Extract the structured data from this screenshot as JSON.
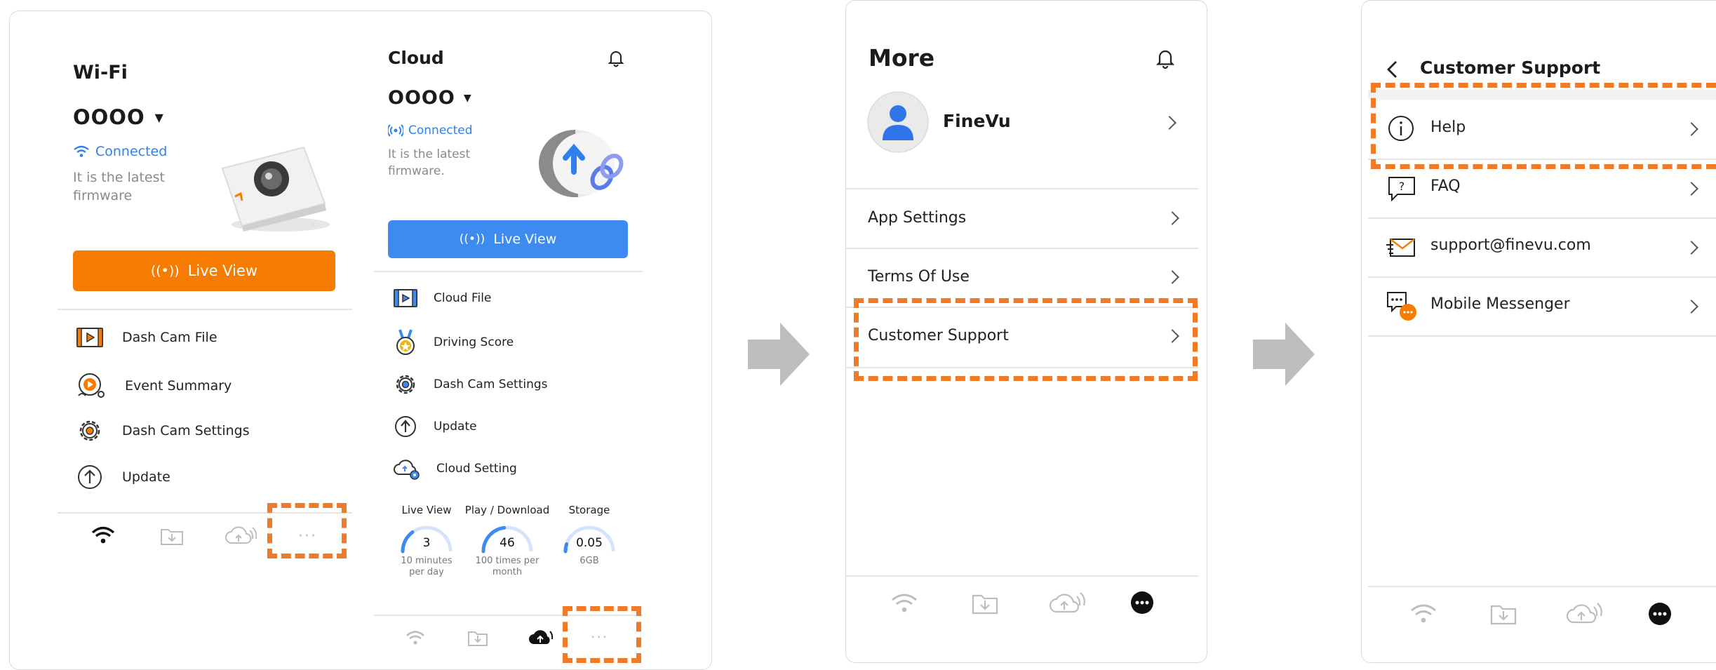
{
  "wifi": {
    "title": "Wi-Fi",
    "device": "OOOO",
    "status": "Connected",
    "firmware": "It is the latest firmware",
    "live_view": "Live View",
    "menu": [
      "Dash Cam File",
      "Event Summary",
      "Dash Cam Settings",
      "Update"
    ]
  },
  "cloud": {
    "title": "Cloud",
    "device": "OOOO",
    "status": "Connected",
    "firmware": "It is the latest firmware.",
    "live_view": "Live View",
    "menu": [
      "Cloud File",
      "Driving Score",
      "Dash Cam Settings",
      "Update",
      "Cloud Setting"
    ],
    "stats": [
      {
        "title": "Live View",
        "value": "3",
        "caption": "10 minutes per day",
        "fraction": 0.3
      },
      {
        "title": "Play / Download",
        "value": "46",
        "caption": "100 times per month",
        "fraction": 0.46
      },
      {
        "title": "Storage",
        "value": "0.05",
        "caption": "6GB",
        "fraction": 0.1
      }
    ]
  },
  "more": {
    "title": "More",
    "profile_name": "FineVu",
    "menu": [
      "App Settings",
      "Terms Of Use",
      "Customer Support"
    ]
  },
  "support": {
    "title": "Customer Support",
    "menu": [
      "Help",
      "FAQ",
      "support@finevu.com",
      "Mobile Messenger"
    ]
  },
  "colors": {
    "accent_orange": "#f57c00",
    "accent_blue": "#3d8bf0",
    "highlight_dash": "#f07a25",
    "arrow_grey": "#bdbdbd"
  },
  "icons": {
    "tabbar": [
      "wifi-icon",
      "download-folder-icon",
      "cloud-icon",
      "more-icon"
    ],
    "notification": "bell-icon"
  }
}
